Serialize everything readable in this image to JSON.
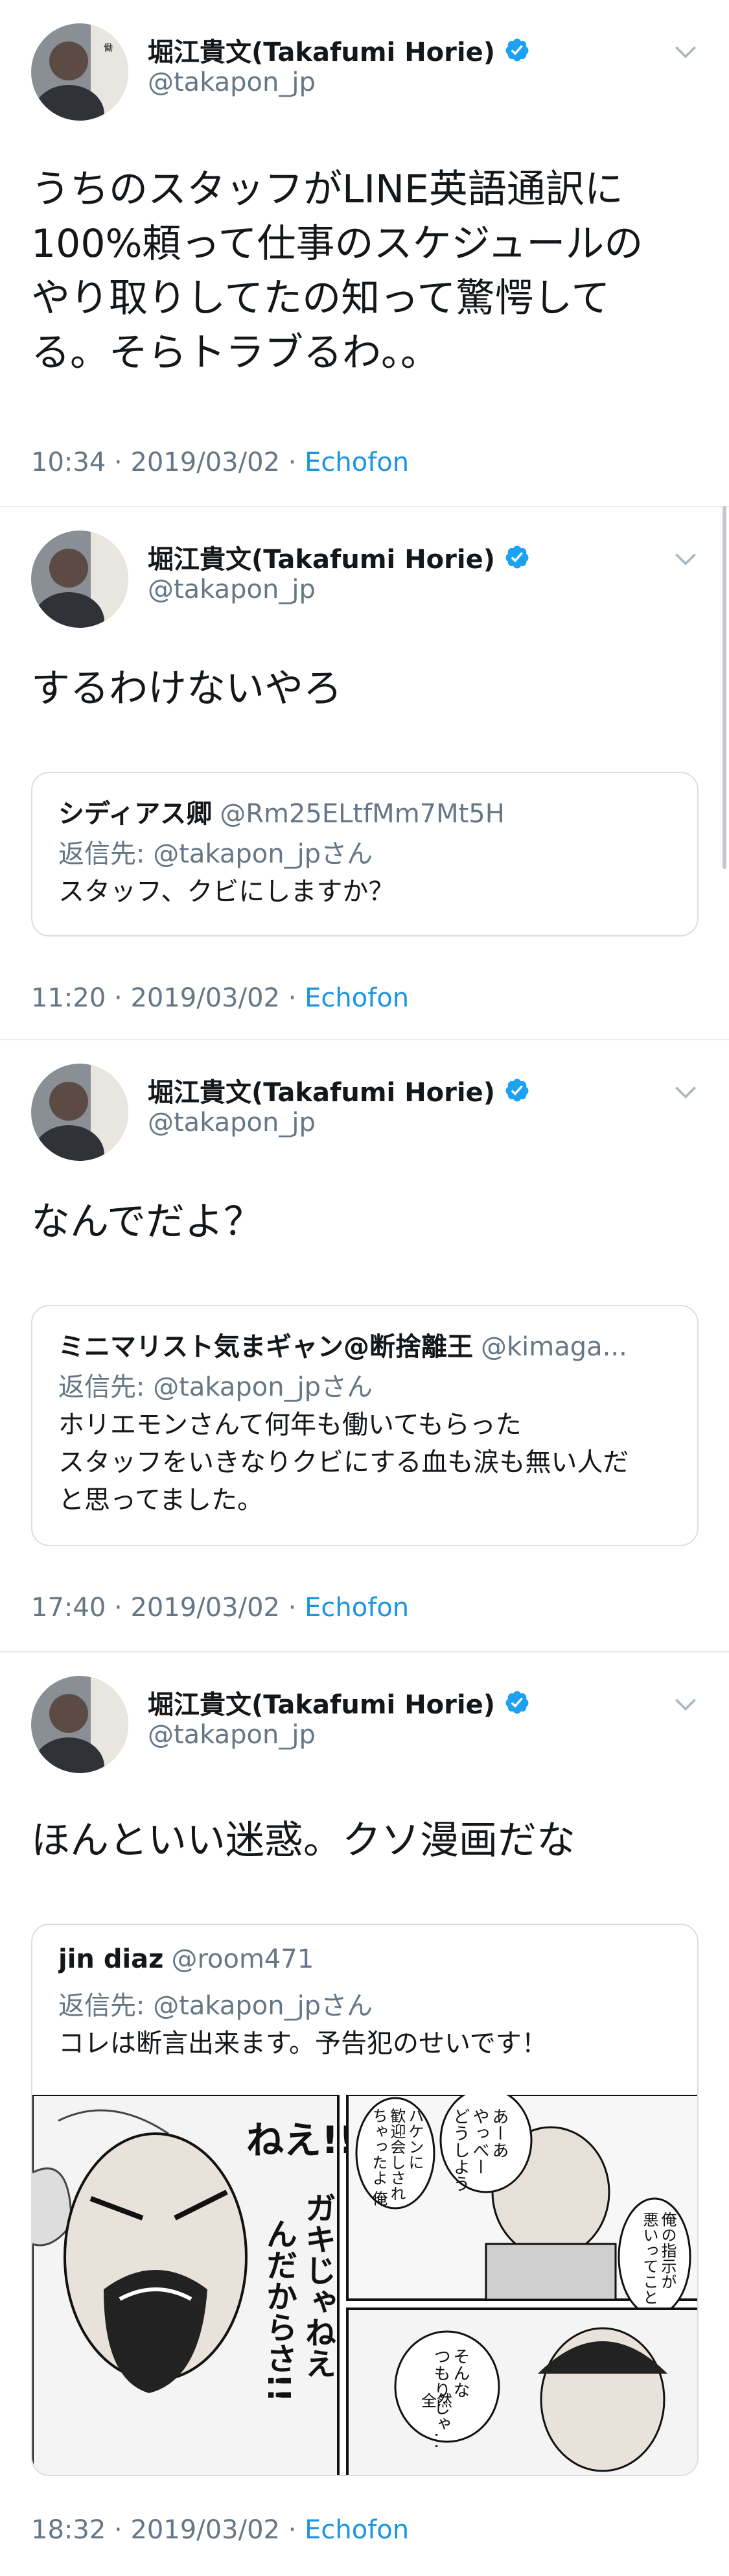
{
  "tweets": [
    {
      "author": {
        "name": "堀江貴文(Takafumi Horie)",
        "handle": "@takapon_jp"
      },
      "text": "うちのスタッフがLINE英語通訳に\n100%頼って仕事のスケジュールの\nやり取りしてたの知って驚愕して\nる。そらトラブるわ。。",
      "time": "10:34",
      "date": "2019/03/02",
      "via": "Echofon"
    },
    {
      "author": {
        "name": "堀江貴文(Takafumi Horie)",
        "handle": "@takapon_jp"
      },
      "text": "するわけないやろ",
      "quote": {
        "name": "シディアス卿",
        "handle": "@Rm25ELtfMm7Mt5H",
        "reply_to": "返信先: @takapon_jpさん",
        "text": "スタッフ、クビにしますか？"
      },
      "time": "11:20",
      "date": "2019/03/02",
      "via": "Echofon"
    },
    {
      "author": {
        "name": "堀江貴文(Takafumi Horie)",
        "handle": "@takapon_jp"
      },
      "text": "なんでだよ？",
      "quote": {
        "name": "ミニマリスト気まギャン@断捨離王",
        "handle": "@kimaga...",
        "reply_to": "返信先: @takapon_jpさん",
        "text": "ホリエモンさんて何年も働いてもらった\nスタッフをいきなりクビにする血も涙も無い人だ\nと思ってました。"
      },
      "time": "17:40",
      "date": "2019/03/02",
      "via": "Echofon"
    },
    {
      "author": {
        "name": "堀江貴文(Takafumi Horie)",
        "handle": "@takapon_jp"
      },
      "text": "ほんといい迷惑。クソ漫画だな",
      "quote": {
        "name": "jin diaz",
        "handle": "@room471",
        "reply_to": "返信先: @takapon_jpさん",
        "text": "コレは断言出来ます。予告犯のせいです！",
        "manga": {
          "shout_1": "ねえ!!",
          "shout_2": "ガキじゃねえ",
          "shout_3": "んだからさ!!",
          "bubble_1": "あーあ\nやっべー\nどうしよう",
          "bubble_2": "ハケンに\n歓迎会しされ\nちゃったよ 俺",
          "bubble_3": "俺の指示が\n悪いってこと",
          "bubble_4": "そんな\nつもりじゃ…",
          "bubble_5": "全然"
        }
      },
      "time": "18:32",
      "date": "2019/03/02",
      "via": "Echofon"
    }
  ],
  "meta_separator": " · ",
  "icons": {
    "verified": "verified-badge-icon",
    "chevron": "chevron-down-icon"
  },
  "colors": {
    "link": "#1b95e0",
    "secondary": "#657786",
    "text": "#14171a",
    "border": "#d8dee3"
  }
}
